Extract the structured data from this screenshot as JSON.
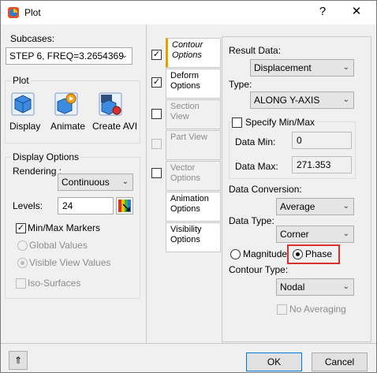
{
  "window": {
    "title": "Plot",
    "help_glyph": "?",
    "close_glyph": "✕"
  },
  "subcases": {
    "label": "Subcases:",
    "value": "STEP 6, FREQ=3.2654369"
  },
  "plot": {
    "group_label": "Plot",
    "display_label": "Display",
    "animate_label": "Animate",
    "create_avi_label": "Create AVI"
  },
  "display_options": {
    "group_label": "Display Options",
    "rendering_label": "Rendering :",
    "rendering_value": "Continuous",
    "levels_label": "Levels:",
    "levels_value": "24",
    "minmax_label": "Min/Max Markers",
    "minmax_checked": true,
    "global_values_label": "Global Values",
    "visible_view_values_label": "Visible View Values",
    "iso_surfaces_label": "Iso-Surfaces"
  },
  "tabs": [
    {
      "label": "Contour Options",
      "checked": true
    },
    {
      "label": "Deform Options",
      "checked": true
    },
    {
      "label": "Section View",
      "checked": false
    },
    {
      "label": "Part View",
      "checked": false
    },
    {
      "label": "Vector Options",
      "checked": false
    },
    {
      "label": "Animation Options"
    },
    {
      "label": "Visibility Options"
    }
  ],
  "contour": {
    "result_data_label": "Result Data:",
    "result_data_value": "Displacement",
    "type_label": "Type:",
    "type_value": "ALONG Y-AXIS",
    "specify_minmax_label": "Specify Min/Max",
    "data_min_label": "Data Min:",
    "data_min_value": "0",
    "data_max_label": "Data Max:",
    "data_max_value": "271.353",
    "data_conversion_label": "Data Conversion:",
    "data_conversion_value": "Average",
    "data_type_label": "Data Type:",
    "data_type_value": "Corner",
    "magnitude_label": "Magnitude",
    "phase_label": "Phase",
    "contour_type_label": "Contour Type:",
    "contour_type_value": "Nodal",
    "no_averaging_label": "No Averaging"
  },
  "footer": {
    "collapse_glyph": "⇑",
    "ok_label": "OK",
    "cancel_label": "Cancel"
  },
  "chevron": "⌄",
  "colors": {
    "highlight": "#d9312e",
    "accent_tab": "#e0a400",
    "primary_border": "#0078d7"
  }
}
